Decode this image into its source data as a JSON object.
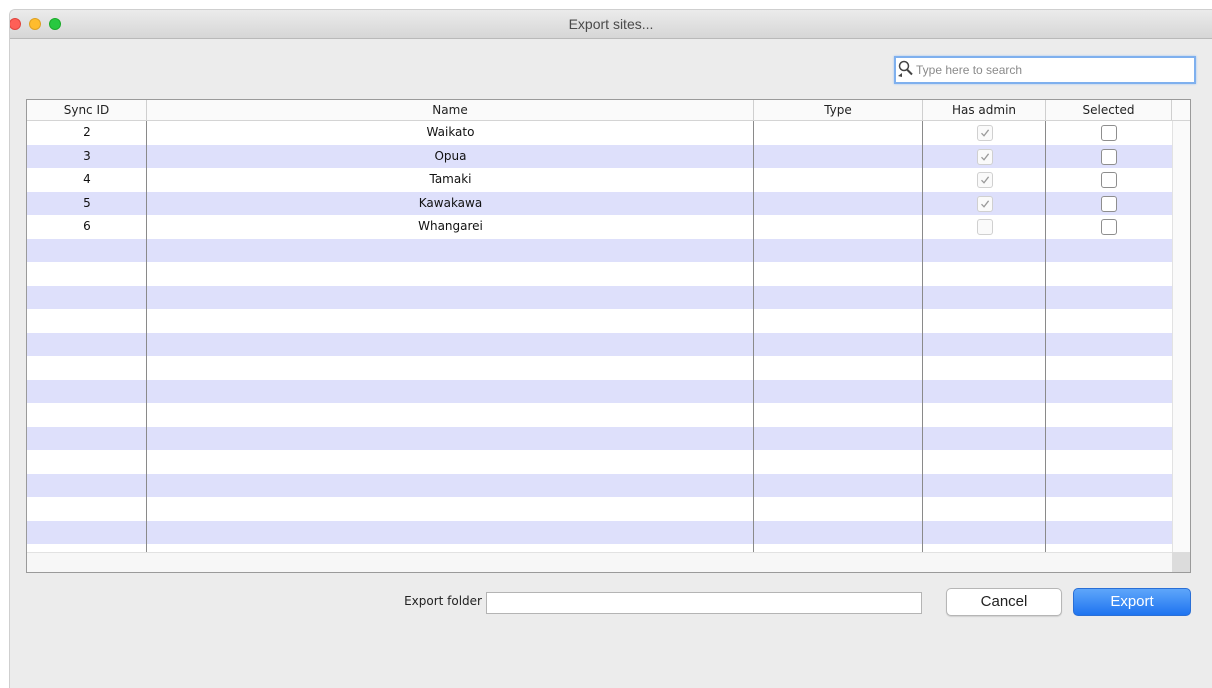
{
  "window": {
    "title": "Export sites..."
  },
  "search": {
    "placeholder": "Type here to search",
    "value": ""
  },
  "table": {
    "columns": [
      "Sync ID",
      "Name",
      "Type",
      "Has admin",
      "Selected"
    ],
    "rows": [
      {
        "sync_id": "2",
        "name": "Waikato",
        "type": "",
        "has_admin": true,
        "selected": false
      },
      {
        "sync_id": "3",
        "name": "Opua",
        "type": "",
        "has_admin": true,
        "selected": false
      },
      {
        "sync_id": "4",
        "name": "Tamaki",
        "type": "",
        "has_admin": true,
        "selected": false
      },
      {
        "sync_id": "5",
        "name": "Kawakawa",
        "type": "",
        "has_admin": true,
        "selected": false
      },
      {
        "sync_id": "6",
        "name": "Whangarei",
        "type": "",
        "has_admin": false,
        "selected": false
      }
    ],
    "stripe_color": "#dee0fb"
  },
  "footer": {
    "export_folder_label": "Export folder",
    "export_folder_value": "",
    "cancel_label": "Cancel",
    "export_label": "Export",
    "accent_color": "#1f74f0"
  }
}
